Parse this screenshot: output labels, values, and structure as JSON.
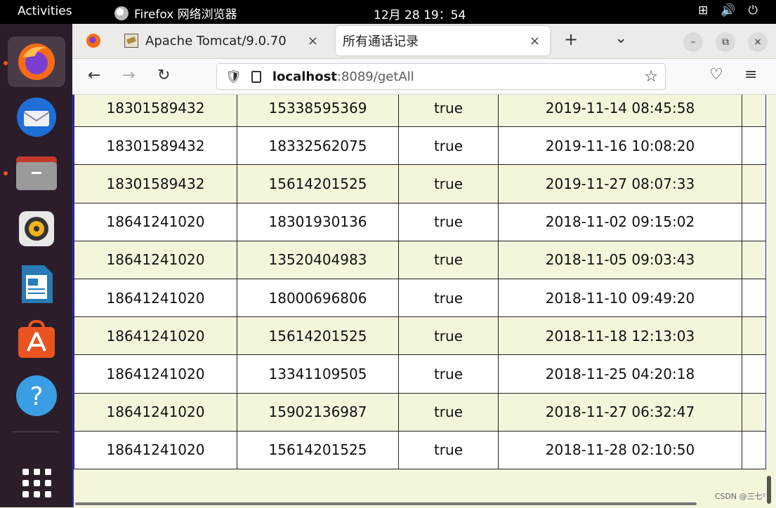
{
  "topbar": {
    "activities": "Activities",
    "app_name": "Firefox 网络浏览器",
    "clock": "12月 28  19：54",
    "tray_network": "⊞",
    "tray_volume": "🔊",
    "tray_power": "⏻"
  },
  "dock": {
    "items": [
      {
        "name": "firefox-icon",
        "active": true
      },
      {
        "name": "thunderbird-icon"
      },
      {
        "name": "files-icon"
      },
      {
        "name": "rhythmbox-icon"
      },
      {
        "name": "libreoffice-writer-icon"
      },
      {
        "name": "software-center-icon"
      },
      {
        "name": "help-icon"
      },
      {
        "name": "app-grid-icon"
      }
    ]
  },
  "browser": {
    "tabs": [
      {
        "label": "Apache Tomcat/9.0.70",
        "close": "×"
      },
      {
        "label": "所有通话记录",
        "close": "×"
      }
    ],
    "new_tab": "+",
    "list_tabs": "⌄",
    "window_controls": {
      "minimize": "–",
      "restore": "⧉",
      "close": "×"
    },
    "nav": {
      "back": "←",
      "forward": "→",
      "reload": "↻",
      "pocket": "♡",
      "menu": "≡"
    },
    "url": {
      "host": "localhost",
      "path": ":8089/getAll"
    },
    "star": "☆"
  },
  "table": {
    "rows": [
      {
        "caller": "18301589432",
        "callee": "15338595369",
        "status": "true",
        "time": "2019-11-14 08:45:58"
      },
      {
        "caller": "18301589432",
        "callee": "18332562075",
        "status": "true",
        "time": "2019-11-16 10:08:20"
      },
      {
        "caller": "18301589432",
        "callee": "15614201525",
        "status": "true",
        "time": "2019-11-27 08:07:33"
      },
      {
        "caller": "18641241020",
        "callee": "18301930136",
        "status": "true",
        "time": "2018-11-02 09:15:02"
      },
      {
        "caller": "18641241020",
        "callee": "13520404983",
        "status": "true",
        "time": "2018-11-05 09:03:43"
      },
      {
        "caller": "18641241020",
        "callee": "18000696806",
        "status": "true",
        "time": "2018-11-10 09:49:20"
      },
      {
        "caller": "18641241020",
        "callee": "15614201525",
        "status": "true",
        "time": "2018-11-18 12:13:03"
      },
      {
        "caller": "18641241020",
        "callee": "13341109505",
        "status": "true",
        "time": "2018-11-25 04:20:18"
      },
      {
        "caller": "18641241020",
        "callee": "15902136987",
        "status": "true",
        "time": "2018-11-27 06:32:47"
      },
      {
        "caller": "18641241020",
        "callee": "15614201525",
        "status": "true",
        "time": "2018-11-28 02:10:50"
      }
    ]
  },
  "watermark": "CSDN @三七²",
  "colors": {
    "page_bg": "#f5f5dc",
    "row_alt": "#ffffff",
    "accent": "#e95420"
  }
}
